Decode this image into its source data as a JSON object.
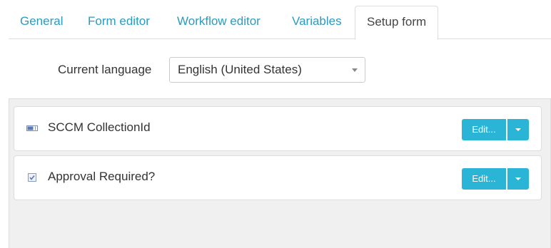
{
  "tabs": [
    {
      "label": "General"
    },
    {
      "label": "Form editor"
    },
    {
      "label": "Workflow editor"
    },
    {
      "label": "Variables"
    },
    {
      "label": "Setup form",
      "active": true
    }
  ],
  "language": {
    "label": "Current language",
    "selected": "English (United States)"
  },
  "fields": [
    {
      "name": "SCCM CollectionId",
      "icon": "textbox-icon",
      "edit_label": "Edit..."
    },
    {
      "name": "Approval Required?",
      "icon": "checkbox-icon",
      "edit_label": "Edit..."
    }
  ],
  "colors": {
    "accent": "#2ab4d6",
    "tab_link": "#2a9bc0"
  }
}
